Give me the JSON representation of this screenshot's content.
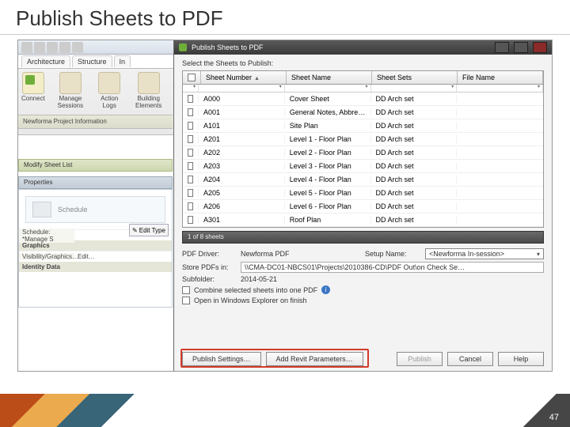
{
  "slide": {
    "title": "Publish Sheets to PDF",
    "page_number": "47"
  },
  "ribbon": {
    "tab_architecture": "Architecture",
    "tab_structure": "Structure",
    "tab_in": "In",
    "btn_connect": "Connect",
    "btn_manage_sessions": "Manage\nSessions",
    "btn_action_logs": "Action\nLogs",
    "btn_building_elements": "Building\nElements",
    "panel_label": "Newforma Project Information"
  },
  "left": {
    "modify": "Modify Sheet List",
    "properties": "Properties",
    "schedule": "Schedule",
    "sched_select": "Schedule: *Manage S",
    "edit_type": "Edit Type",
    "group_graphics": "Graphics",
    "row_visibility_k": "Visibility/Graphics…",
    "row_visibility_v": "Edit…",
    "group_identity": "Identity Data"
  },
  "dialog": {
    "title": "Publish Sheets to PDF",
    "instruction": "Select the Sheets to Publish:",
    "col_number": "Sheet Number",
    "col_name": "Sheet Name",
    "col_sets": "Sheet Sets",
    "col_file": "File Name",
    "section_sheets": "1 of 8 sheets",
    "rows": [
      {
        "num": "A000",
        "name": "Cover Sheet",
        "sets": "DD Arch set",
        "file": ""
      },
      {
        "num": "A001",
        "name": "General Notes, Abbrevi…",
        "sets": "DD Arch set",
        "file": ""
      },
      {
        "num": "A101",
        "name": "Site Plan",
        "sets": "DD Arch set",
        "file": ""
      },
      {
        "num": "A201",
        "name": "Level 1 - Floor Plan",
        "sets": "DD Arch set",
        "file": ""
      },
      {
        "num": "A202",
        "name": "Level 2 - Floor Plan",
        "sets": "DD Arch set",
        "file": ""
      },
      {
        "num": "A203",
        "name": "Level 3 - Floor Plan",
        "sets": "DD Arch set",
        "file": ""
      },
      {
        "num": "A204",
        "name": "Level 4 - Floor Plan",
        "sets": "DD Arch set",
        "file": ""
      },
      {
        "num": "A205",
        "name": "Level 5 - Floor Plan",
        "sets": "DD Arch set",
        "file": ""
      },
      {
        "num": "A206",
        "name": "Level 6 - Floor Plan",
        "sets": "DD Arch set",
        "file": ""
      },
      {
        "num": "A301",
        "name": "Roof Plan",
        "sets": "DD Arch set",
        "file": ""
      }
    ],
    "lbl_driver": "PDF Driver:",
    "val_driver": "Newforma PDF",
    "lbl_setup": "Setup Name:",
    "val_setup": "<Newforma In-session>",
    "lbl_store": "Store PDFs in:",
    "val_store": "\\\\CMA-DC01-NBCS01\\Projects\\2010386-CD\\PDF Out\\on Check Se…",
    "lbl_subfolder": "Subfolder:",
    "val_subfolder": "2014-05-21",
    "chk_combine": "Combine selected sheets into one PDF",
    "chk_open_explorer": "Open in Windows Explorer on finish",
    "btn_publish_settings": "Publish Settings…",
    "btn_add_revit_params": "Add Revit Parameters…",
    "btn_publish": "Publish",
    "btn_cancel": "Cancel",
    "btn_help": "Help"
  }
}
